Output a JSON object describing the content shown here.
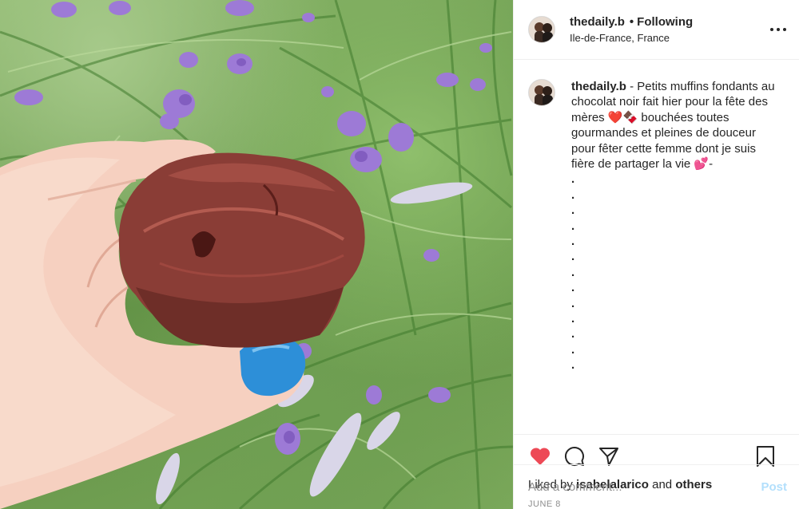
{
  "post": {
    "image_alt": "muffin held in hand over lavender field",
    "colors": {
      "like_red": "#ed4956",
      "post_blue": "#b2dffc",
      "nail_blue": "#2d8fd8"
    }
  },
  "header": {
    "username": "thedaily.b",
    "separator": "•",
    "follow_status": "Following",
    "location": "Ile-de-France, France",
    "more_icon": "more-horizontal-icon"
  },
  "caption": {
    "username": "thedaily.b",
    "text_part1": " - Petits muffins fondants au chocolat noir fait hier pour la fête des mères ",
    "emoji1": "❤️",
    "emoji2": "🍫",
    "text_part2": " bouchées toutes gourmandes et pleines de douceur pour fêter cette femme dont je suis fière de partager la vie ",
    "emoji3": "💕",
    "text_part3": "-",
    "dots": [
      ".",
      ".",
      ".",
      ".",
      ".",
      ".",
      ".",
      ".",
      ".",
      ".",
      ".",
      ".",
      "."
    ]
  },
  "actions": {
    "like_icon": "heart-filled-icon",
    "comment_icon": "comment-icon",
    "share_icon": "share-icon",
    "save_icon": "bookmark-icon"
  },
  "likes": {
    "prefix": "Liked by ",
    "user": "isabelalarico",
    "middle": " and ",
    "others": "others"
  },
  "date": "JUNE 8",
  "comment": {
    "placeholder": "Add a comment...",
    "post_label": "Post"
  }
}
